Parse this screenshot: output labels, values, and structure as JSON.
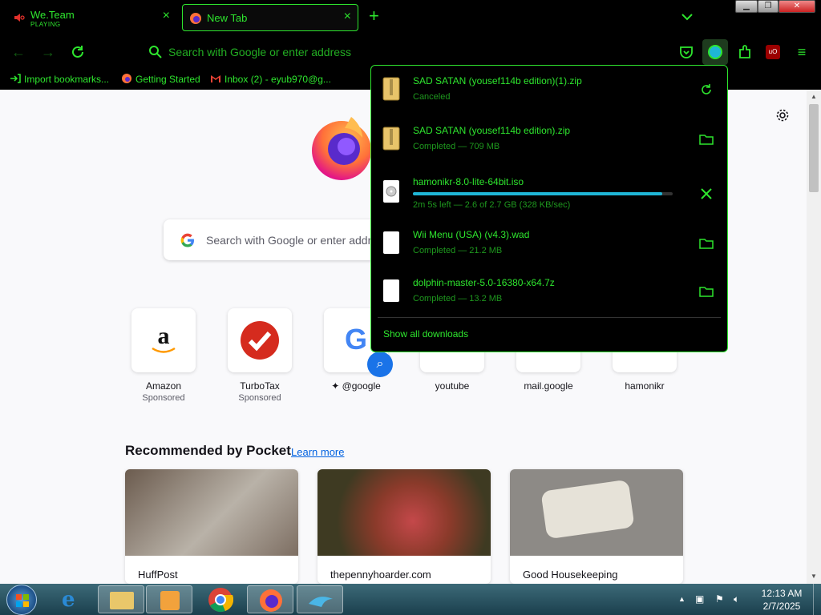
{
  "tabs": [
    {
      "title": "We.Team",
      "subtitle": "PLAYING"
    },
    {
      "title": "New Tab"
    }
  ],
  "navbar": {
    "url_placeholder": "Search with Google or enter address"
  },
  "bookmarks": [
    {
      "label": "Import bookmarks...",
      "icon": "import-icon"
    },
    {
      "label": "Getting Started",
      "icon": "firefox-icon"
    },
    {
      "label": "Inbox (2) - eyub970@g...",
      "icon": "gmail-icon"
    }
  ],
  "newtab": {
    "search_placeholder": "Search with Google or enter address",
    "shortcuts": [
      {
        "name": "Amazon",
        "sponsored": "Sponsored"
      },
      {
        "name": "TurboTax",
        "sponsored": "Sponsored"
      },
      {
        "name": "@google"
      },
      {
        "name": "youtube"
      },
      {
        "name": "mail.google"
      },
      {
        "name": "hamonikr"
      }
    ],
    "pocket_title": "Recommended by Pocket",
    "learn_more": "Learn more",
    "cards": [
      {
        "source": "HuffPost"
      },
      {
        "source": "thepennyhoarder.com"
      },
      {
        "source": "Good Housekeeping"
      }
    ]
  },
  "downloads": {
    "items": [
      {
        "name": "SAD SATAN (yousef114b edition)(1).zip",
        "status": "Canceled",
        "action": "retry-icon",
        "type": "zip"
      },
      {
        "name": "SAD SATAN (yousef114b edition).zip",
        "status": "Completed — 709 MB",
        "action": "folder-icon",
        "type": "zip"
      },
      {
        "name": "hamonikr-8.0-lite-64bit.iso",
        "status": "2m 5s left — 2.6 of 2.7 GB (328 KB/sec)",
        "action": "cancel-icon",
        "type": "iso",
        "progress": 0.96
      },
      {
        "name": "Wii Menu (USA) (v4.3).wad",
        "status": "Completed — 21.2 MB",
        "action": "folder-icon",
        "type": "file"
      },
      {
        "name": "dolphin-master-5.0-16380-x64.7z",
        "status": "Completed — 13.2 MB",
        "action": "folder-icon",
        "type": "file"
      }
    ],
    "show_all": "Show all downloads"
  },
  "taskbar": {
    "time": "12:13 AM",
    "date": "2/7/2025"
  },
  "colors": {
    "accent": "#2ee62e",
    "progress": "#1fb6d6"
  }
}
